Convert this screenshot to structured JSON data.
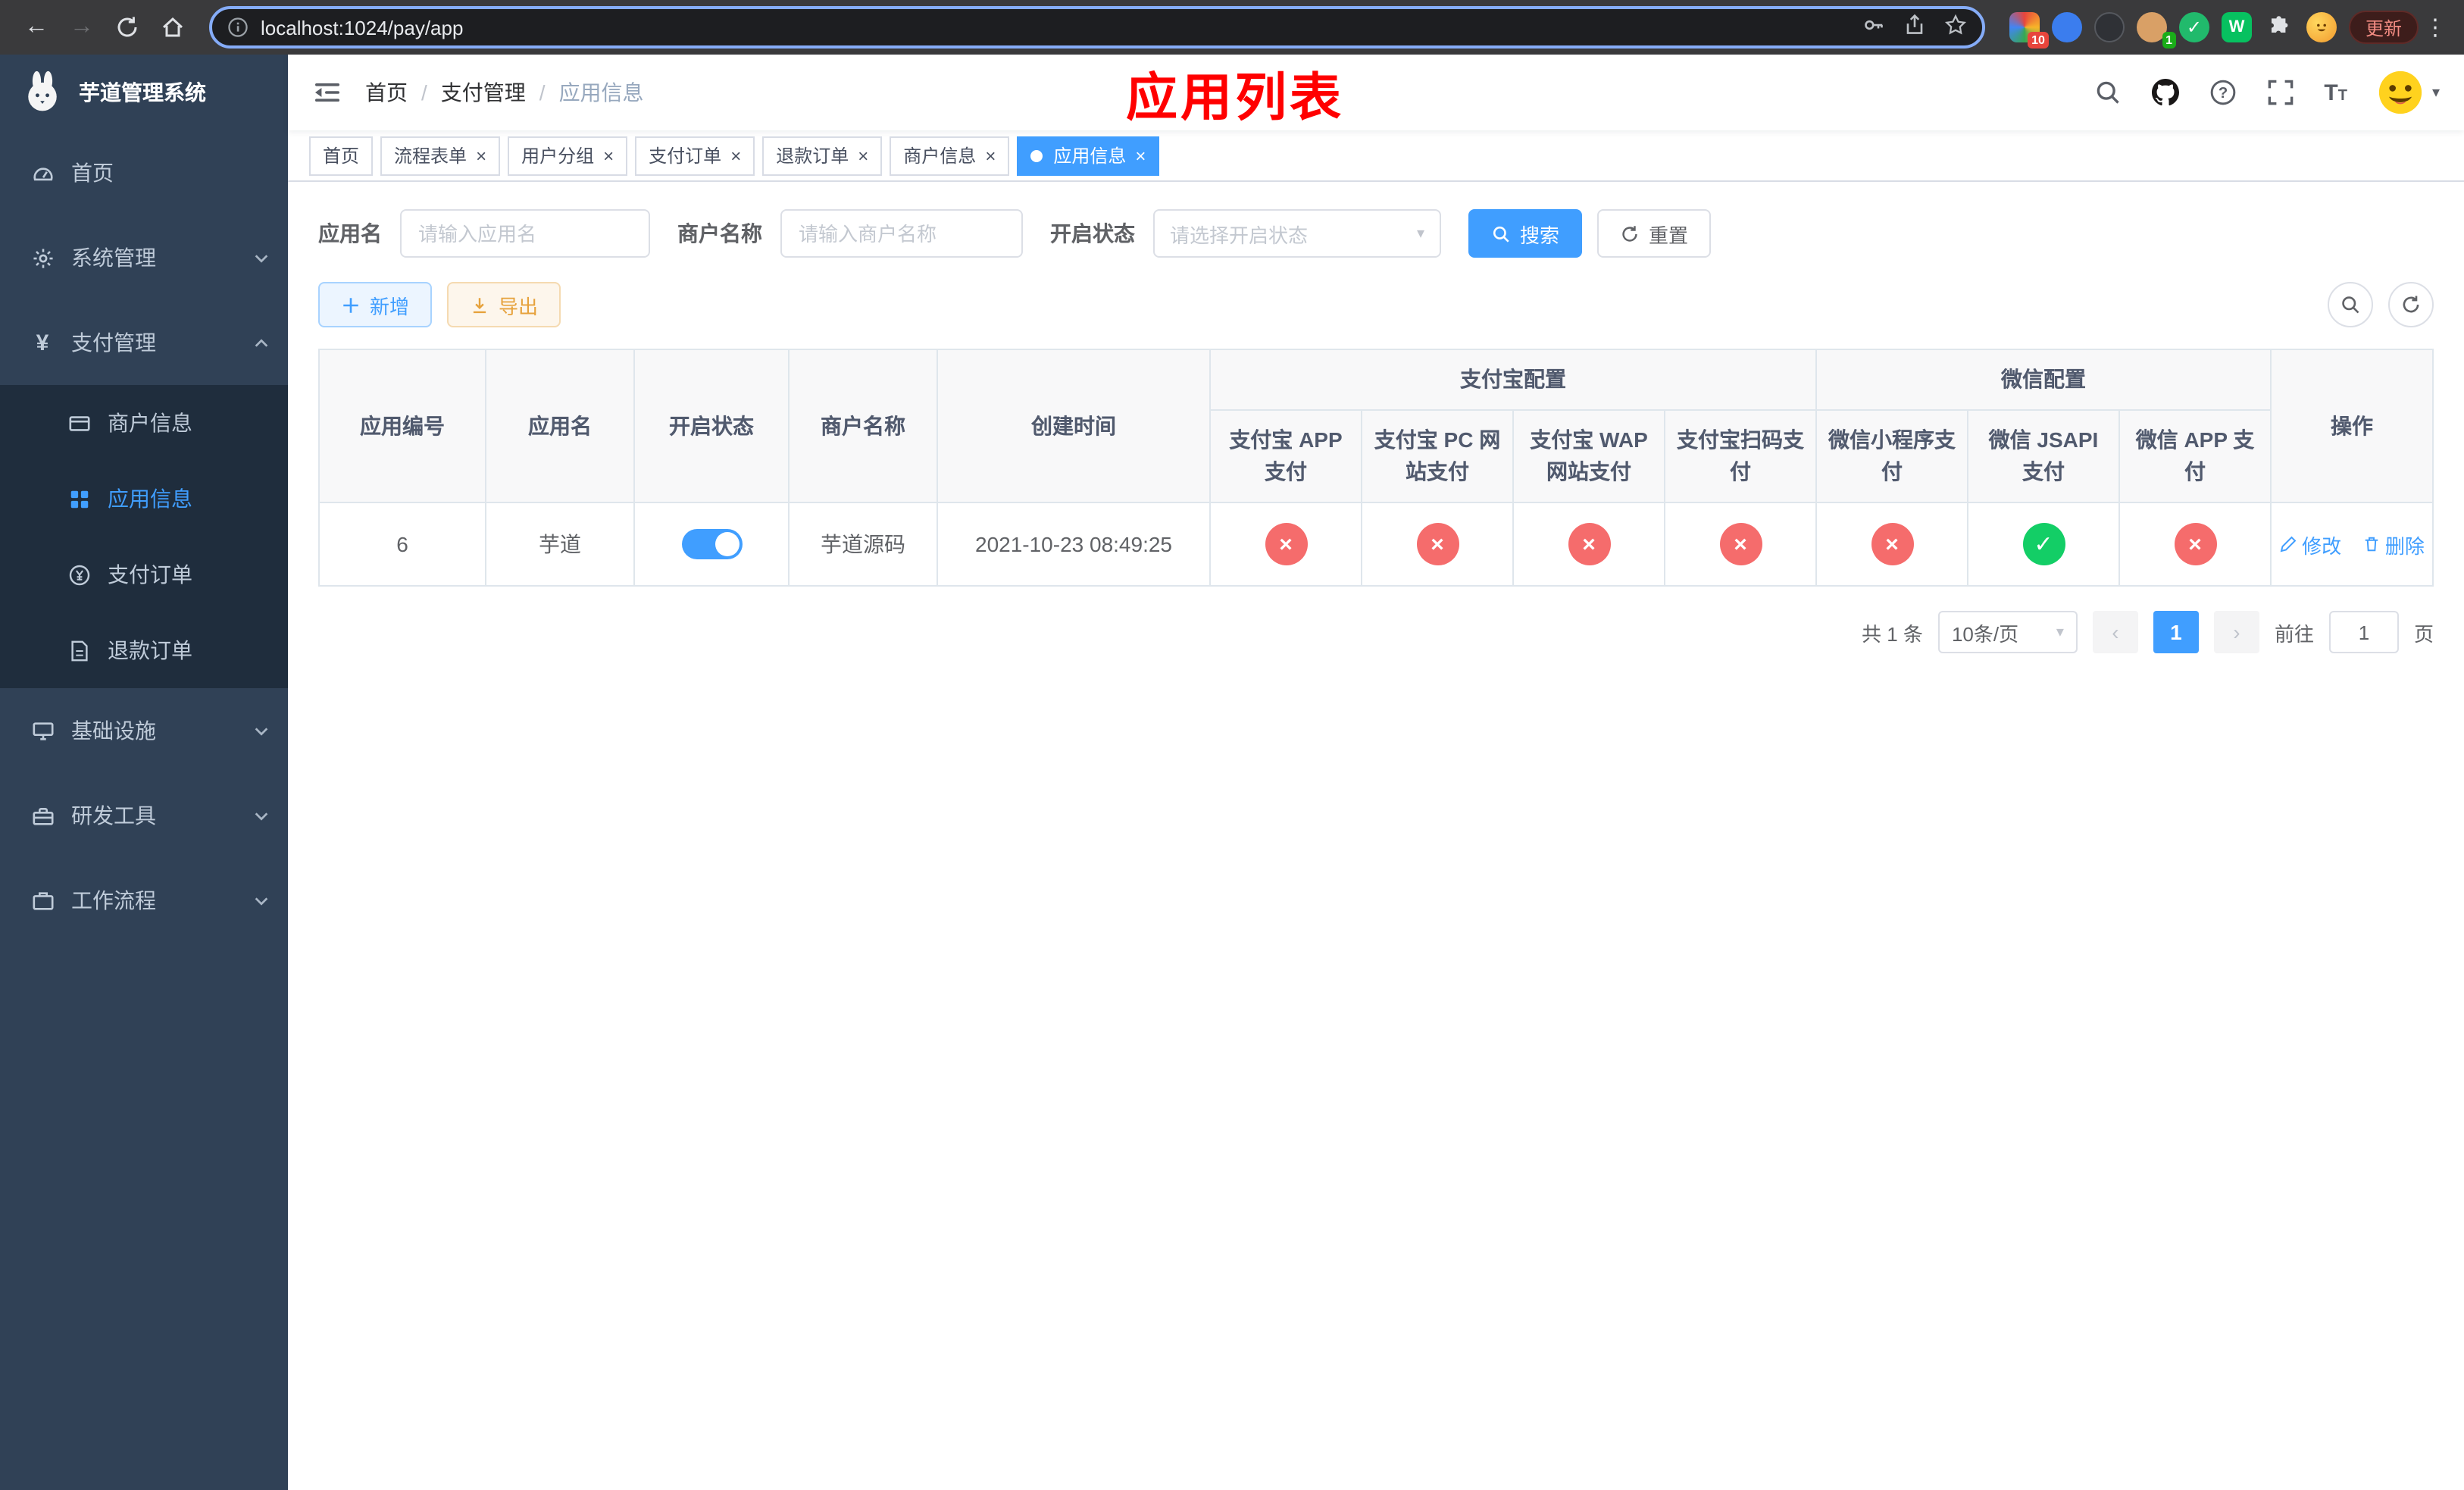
{
  "browser": {
    "url": "localhost:1024/pay/app",
    "update_button": "更新",
    "ext_badge_a": "10",
    "ext_badge_b": "1"
  },
  "sidebar": {
    "app_title": "芋道管理系统",
    "menu": [
      {
        "label": "首页"
      },
      {
        "label": "系统管理"
      },
      {
        "label": "支付管理"
      },
      {
        "label": "基础设施"
      },
      {
        "label": "研发工具"
      },
      {
        "label": "工作流程"
      }
    ],
    "payment_submenu": [
      {
        "label": "商户信息"
      },
      {
        "label": "应用信息"
      },
      {
        "label": "支付订单"
      },
      {
        "label": "退款订单"
      }
    ]
  },
  "header": {
    "breadcrumb": [
      "首页",
      "支付管理",
      "应用信息"
    ],
    "page_title": "应用列表"
  },
  "tabs": [
    {
      "label": "首页",
      "closable": false,
      "active": false
    },
    {
      "label": "流程表单",
      "closable": true,
      "active": false
    },
    {
      "label": "用户分组",
      "closable": true,
      "active": false
    },
    {
      "label": "支付订单",
      "closable": true,
      "active": false
    },
    {
      "label": "退款订单",
      "closable": true,
      "active": false
    },
    {
      "label": "商户信息",
      "closable": true,
      "active": false
    },
    {
      "label": "应用信息",
      "closable": true,
      "active": true
    }
  ],
  "filters": {
    "app_name_label": "应用名",
    "app_name_placeholder": "请输入应用名",
    "merchant_name_label": "商户名称",
    "merchant_name_placeholder": "请输入商户名称",
    "status_label": "开启状态",
    "status_placeholder": "请选择开启状态",
    "search_button": "搜索",
    "reset_button": "重置"
  },
  "toolbar": {
    "add_button": "新增",
    "export_button": "导出"
  },
  "table": {
    "headers": {
      "app_id": "应用编号",
      "app_name": "应用名",
      "status": "开启状态",
      "merchant_name": "商户名称",
      "create_time": "创建时间",
      "alipay_group": "支付宝配置",
      "wechat_group": "微信配置",
      "actions": "操作",
      "alipay_app": "支付宝 APP 支付",
      "alipay_pc": "支付宝 PC 网站支付",
      "alipay_wap": "支付宝 WAP 网站支付",
      "alipay_scan": "支付宝扫码支付",
      "wechat_lite": "微信小程序支付",
      "wechat_jsapi": "微信 JSAPI 支付",
      "wechat_app": "微信 APP 支付"
    },
    "row": {
      "app_id": "6",
      "app_name": "芋道",
      "enabled": true,
      "merchant_name": "芋道源码",
      "create_time": "2021-10-23 08:49:25",
      "statuses": [
        false,
        false,
        false,
        false,
        false,
        true,
        false
      ],
      "edit_label": "修改",
      "delete_label": "删除"
    }
  },
  "pagination": {
    "total_text": "共 1 条",
    "page_size": "10条/页",
    "current_page": "1",
    "goto_label": "前往",
    "goto_value": "1",
    "page_unit": "页"
  },
  "colors": {
    "primary": "#409eff",
    "success": "#13ce66",
    "danger": "#f56c6c",
    "sidebar_bg": "#304156",
    "submenu_bg": "#1f2d3d",
    "title_red": "#ff0000"
  }
}
